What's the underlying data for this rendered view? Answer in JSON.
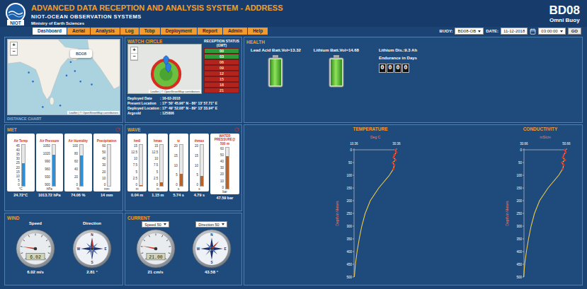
{
  "header": {
    "logo": "NIOT",
    "title": "ADVANCED DATA RECEPTION AND ANALYSIS SYSTEM - ADDRESS",
    "org": "NIOT-OCEAN OBSERVATION SYSTEMS",
    "ministry": "Ministry of Earth Sciences",
    "buoy_id": "BD08",
    "buoy_type": "Omni Buoy"
  },
  "tabs": [
    {
      "label": "Dashboard",
      "selected": true
    },
    {
      "label": "Aerial",
      "selected": false
    },
    {
      "label": "Analysis",
      "selected": false
    },
    {
      "label": "Log",
      "selected": false
    },
    {
      "label": "Tcbp",
      "selected": false
    },
    {
      "label": "Deployment",
      "selected": false
    },
    {
      "label": "Report",
      "selected": false
    },
    {
      "label": "Admin",
      "selected": false
    },
    {
      "label": "Help",
      "selected": false
    }
  ],
  "filters": {
    "buoy_label": "BUOY:",
    "buoy": "BD08-OB",
    "date_label": "DATE:",
    "date": "11-12-2018",
    "time": "03:00:00",
    "go": "GO"
  },
  "map": {
    "popup": "BD08",
    "zoom_in": "+",
    "zoom_out": "−",
    "attribution": "Leaflet | © OpenStreetMap contributors",
    "footer": "DISTANCE CHART"
  },
  "watch_circle": {
    "title": "WATCH CIRCLE",
    "zoom_in": "+",
    "zoom_out": "−",
    "attribution": "Leaflet | © OpenStreetMap contributors",
    "info": [
      {
        "label": "Deployed Date",
        "value": ": 16-02-2018"
      },
      {
        "label": "Present  Location",
        "value": ": 17° 50' 45.96\" N - 86° 13' 57.71\" E"
      },
      {
        "label": "Deployed Location",
        "value": ": 17° 49' 52.08\" N - 89° 13' 33.94\" E"
      },
      {
        "label": "ArgosId",
        "value": ": 125806"
      }
    ],
    "reception": {
      "title": "RECEPTION STATUS (GMT)",
      "slots": [
        {
          "hour": "00",
          "received": true,
          "color": "#2e9b3a"
        },
        {
          "hour": "03",
          "received": true,
          "color": "#2e9b3a"
        },
        {
          "hour": "06",
          "received": false,
          "color": "#b3241f"
        },
        {
          "hour": "09",
          "received": false,
          "color": "#b3241f"
        },
        {
          "hour": "12",
          "received": false,
          "color": "#b3241f"
        },
        {
          "hour": "15",
          "received": false,
          "color": "#b3241f"
        },
        {
          "hour": "18",
          "received": false,
          "color": "#b3241f"
        },
        {
          "hour": "21",
          "received": false,
          "color": "#b3241f"
        }
      ]
    }
  },
  "health": {
    "title": "HEALTH",
    "batteries": [
      {
        "label": "Lead Acid Batt.Vol=13.32",
        "level": 1
      },
      {
        "label": "Lithium Batt.Vol=14.68",
        "level": 1
      }
    ],
    "lithium_discharge": "Lithium Dis.:9.3 Ah",
    "endurance_label": "Endurance in Days",
    "endurance_digits": [
      "0",
      "0",
      "0",
      "0"
    ]
  },
  "met": {
    "title": "MET",
    "gauges": [
      {
        "name": "Air Temp",
        "ticks": [
          "45",
          "40",
          "35",
          "30",
          "25",
          "20",
          "15",
          "10",
          "5",
          "0"
        ],
        "unit": "°C",
        "level": 0.55,
        "reading": "24.72°C"
      },
      {
        "name": "Air Pressure",
        "ticks": [
          "1050",
          "1020",
          "990",
          "960",
          "930",
          "900"
        ],
        "unit": "hPa",
        "level": 0.76,
        "reading": "1013.72 hPa"
      },
      {
        "name": "Air Humidity",
        "ticks": [
          "100",
          "80",
          "60",
          "40",
          "20",
          "0"
        ],
        "unit": "%",
        "level": 0.74,
        "reading": "74.06 %"
      },
      {
        "name": "Precipitation",
        "ticks": [
          "60",
          "50",
          "40",
          "30",
          "20",
          "10",
          "0"
        ],
        "unit": "mm",
        "level": 0,
        "reading": "14 mm"
      }
    ]
  },
  "wave": {
    "title": "WAVE",
    "gauges": [
      {
        "name": "hm0",
        "sub": "",
        "ticks": [
          "15",
          "12.5",
          "10",
          "7.5",
          "5",
          "2.5",
          "0"
        ],
        "unit": "m",
        "level": 0.01,
        "reading": "0.04 m"
      },
      {
        "name": "hmax",
        "sub": "",
        "ticks": [
          "15",
          "12.5",
          "10",
          "7.5",
          "5",
          "2.5",
          "0"
        ],
        "unit": "m",
        "level": 0.08,
        "reading": "1.15 m"
      },
      {
        "name": "tz",
        "sub": "",
        "ticks": [
          "20",
          "15",
          "10",
          "5",
          "0"
        ],
        "unit": "s",
        "level": 0.29,
        "reading": "5.74 s"
      },
      {
        "name": "thmax",
        "sub": "",
        "ticks": [
          "20",
          "15",
          "10",
          "5",
          "0"
        ],
        "unit": "s",
        "level": 0.24,
        "reading": "4.79 s"
      },
      {
        "name": "WATER PRESSURE@",
        "sub": "500 m",
        "ticks": [
          "60",
          "50",
          "40",
          "30",
          "20",
          "10",
          "0"
        ],
        "unit": "bar",
        "level": 0.79,
        "reading": "47.59 bar"
      }
    ]
  },
  "wind": {
    "title": "WIND",
    "speed": {
      "label": "Speed",
      "display": "6.02",
      "level": 0.2,
      "reading": "6.02 m/s"
    },
    "direction": {
      "label": "Direction",
      "heading": 2.81,
      "reading": "2.81 °",
      "cardinals": [
        "N",
        "E",
        "S",
        "W"
      ]
    }
  },
  "current": {
    "title": "CURRENT",
    "speed_select": "Speed 50",
    "direction_select": "Direction 50",
    "speed": {
      "display": "21.00",
      "level": 0.21,
      "reading": "21 cm/s"
    },
    "direction": {
      "heading": 43.58,
      "reading": "43.58 °",
      "cardinals": [
        "N",
        "E",
        "S",
        "W"
      ]
    }
  },
  "profiles": [
    {
      "title": "TEMPERATURE",
      "unit": "Deg C",
      "x_ticks": [
        "10.36",
        "30.36"
      ],
      "y_label": "Depth in Meters",
      "y_ticks": [
        "0",
        "50",
        "100",
        "150",
        "200",
        "250",
        "300",
        "350",
        "400",
        "450",
        "500"
      ],
      "depths": [
        0,
        10,
        20,
        30,
        40,
        50,
        60,
        75,
        100,
        125,
        150,
        200,
        250,
        300,
        350,
        400,
        450,
        500
      ],
      "values": [
        29.8,
        30.2,
        29.4,
        29.0,
        29.9,
        28.6,
        29.3,
        28.9,
        27.0,
        24.5,
        22.0,
        18.0,
        15.6,
        14.0,
        12.8,
        11.8,
        11.0,
        10.5
      ],
      "flagged": [
        true,
        true,
        true,
        true,
        true,
        true,
        true,
        true,
        false,
        false,
        false,
        false,
        false,
        false,
        false,
        false,
        false,
        false
      ]
    },
    {
      "title": "CONDUCTIVITY",
      "unit": "mS/cm",
      "x_ticks": [
        "30.66",
        "50.66"
      ],
      "y_label": "Depth in Meters",
      "y_ticks": [
        "0",
        "50",
        "100",
        "150",
        "200",
        "250",
        "300",
        "350",
        "400",
        "450",
        "500"
      ],
      "depths": [
        0,
        10,
        20,
        30,
        40,
        50,
        60,
        75,
        100,
        125,
        150,
        200,
        250,
        300,
        350,
        400,
        450,
        500
      ],
      "values": [
        49.9,
        50.3,
        49.4,
        49.0,
        50.0,
        48.6,
        49.3,
        48.9,
        47.0,
        44.5,
        42.0,
        38.0,
        35.6,
        34.0,
        32.8,
        31.8,
        31.0,
        30.5
      ],
      "flagged": [
        true,
        true,
        true,
        true,
        true,
        true,
        true,
        true,
        false,
        false,
        false,
        false,
        false,
        false,
        false,
        false,
        false,
        false
      ]
    }
  ]
}
